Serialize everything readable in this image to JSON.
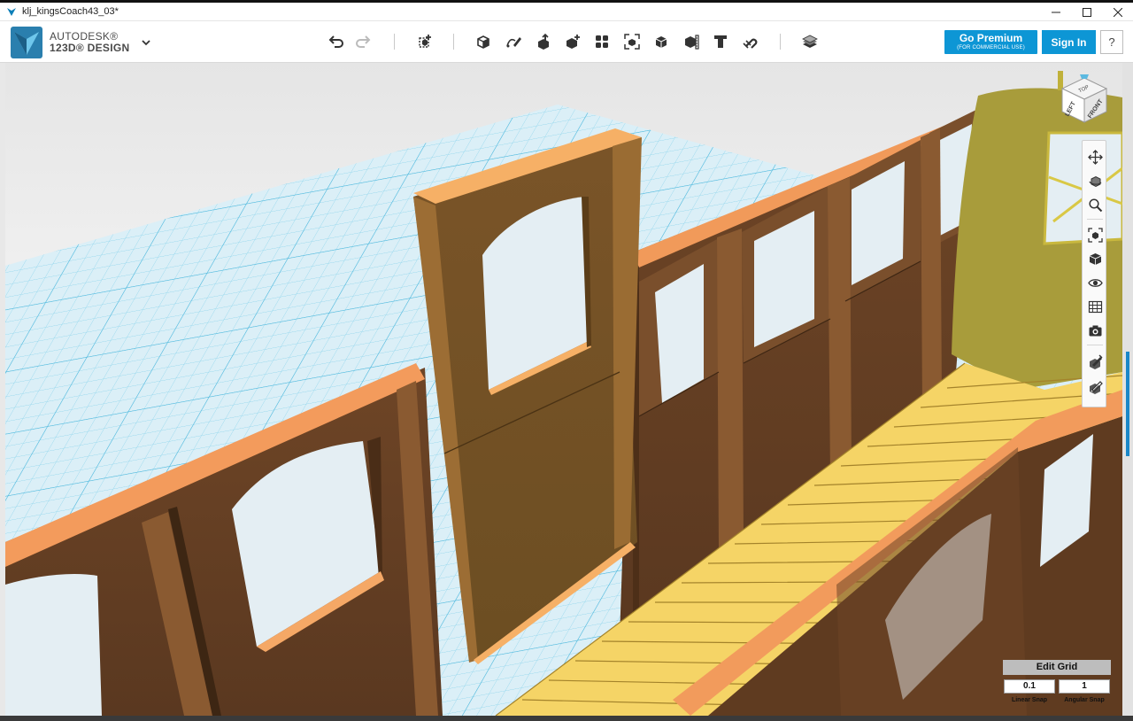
{
  "window": {
    "title": "klj_kingsCoach43_03*",
    "controls": {
      "minimize": "minimize-icon",
      "maximize": "maximize-icon",
      "close": "close-icon"
    }
  },
  "app": {
    "brand_line1": "AUTODESK®",
    "brand_line2": "123D® DESIGN",
    "brand_icon": "autodesk-logo-icon",
    "menu_icon": "chevron-down-icon"
  },
  "toolbar": {
    "undo": "undo-icon",
    "redo": "redo-icon",
    "tools": [
      "transform-icon",
      "primitives-icon",
      "sketch-icon",
      "construct-icon",
      "modify-icon",
      "pattern-icon",
      "grouping-icon",
      "combine-icon",
      "measure-icon",
      "text-icon",
      "snap-icon",
      "material-icon"
    ]
  },
  "account": {
    "premium_label": "Go Premium",
    "premium_sublabel": "(FOR COMMERCIAL USE)",
    "signin_label": "Sign In",
    "help_label": "?"
  },
  "viewcube": {
    "top": "TOP",
    "left": "LEFT",
    "front": "FRONT"
  },
  "navbar": {
    "items": [
      "pan-icon",
      "orbit-icon",
      "zoom-icon",
      "fit-icon",
      "views-icon",
      "visibility-icon",
      "material-display-icon",
      "screenshot-icon",
      "snap-options-icon",
      "selection-filter-icon"
    ]
  },
  "edit_grid": {
    "title": "Edit Grid",
    "linear_snap_value": "0.1",
    "angular_snap_value": "1",
    "linear_snap_label": "Linear Snap",
    "angular_snap_label": "Angular Snap"
  },
  "colors": {
    "accent": "#0d96d5",
    "grid_line": "#7fd0ea",
    "grid_bg": "#d8eef6",
    "wall_dark": "#6b4426",
    "wall_mid": "#7c532f",
    "wall_top": "#f39a5b",
    "door": "#85602f",
    "door_top": "#f6b066",
    "floor": "#f6d466",
    "floor_line": "#9d7d2a",
    "olive": "#a79a3a"
  }
}
